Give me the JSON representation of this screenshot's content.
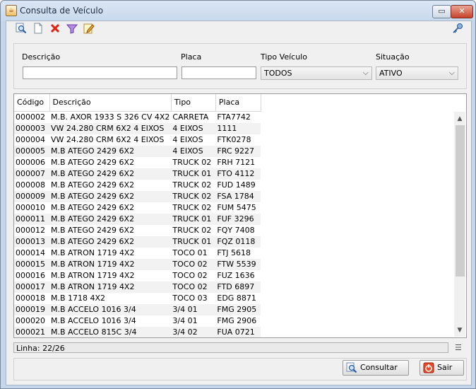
{
  "window": {
    "title": "Consulta de Veículo"
  },
  "toolbar": {
    "icons": [
      "search-document-icon",
      "new-document-icon",
      "delete-icon",
      "filter-icon",
      "edit-icon",
      "key-icon"
    ]
  },
  "filters": {
    "descricao_label": "Descrição",
    "descricao_value": "",
    "placa_label": "Placa",
    "placa_value": "",
    "tipo_label": "Tipo Veículo",
    "tipo_value": "TODOS",
    "situacao_label": "Situação",
    "situacao_value": "ATIVO"
  },
  "table": {
    "headers": [
      "Código",
      "Descrição",
      "Tipo",
      "Placa"
    ],
    "rows": [
      [
        "000002",
        "M.B. AXOR 1933 S 326 CV 4X2",
        "CARRETA",
        "FTA7742"
      ],
      [
        "000003",
        "VW 24.280 CRM 6X2 4 EIXOS",
        "4 EIXOS",
        "1111"
      ],
      [
        "000004",
        "VW 24.280 CRM 6X2 4 EIXOS",
        "4 EIXOS",
        "FTK0278"
      ],
      [
        "000005",
        "M.B ATEGO 2429 6X2",
        "4 EIXOS",
        "FRC 9227"
      ],
      [
        "000006",
        "M.B ATEGO 2429 6X2",
        "TRUCK 02",
        "FRH 7121"
      ],
      [
        "000007",
        "M.B ATEGO 2429 6X2",
        "TRUCK 01",
        "FTO 4112"
      ],
      [
        "000008",
        "M.B ATEGO 2429 6X2",
        "TRUCK 02",
        "FUD 1489"
      ],
      [
        "000009",
        "M.B ATEGO 2429 6X2",
        "TRUCK 02",
        "FSA 1784"
      ],
      [
        "000010",
        "M.B ATEGO 2429 6X2",
        "TRUCK 02",
        "FUM 5475"
      ],
      [
        "000011",
        "M.B ATEGO 2429 6X2",
        "TRUCK 01",
        "FUF 3296"
      ],
      [
        "000012",
        "M.B ATEGO 2429 6X2",
        "TRUCK 02",
        "FQY 7408"
      ],
      [
        "000013",
        "M.B ATEGO 2429 6X2",
        "TRUCK 01",
        "FQZ 0118"
      ],
      [
        "000014",
        "M.B ATRON 1719 4X2",
        "TOCO 01",
        "FTJ 5618"
      ],
      [
        "000015",
        "M.B ATRON 1719 4X2",
        "TOCO 02",
        "FTW 5539"
      ],
      [
        "000016",
        "M.B ATRON 1719 4X2",
        "TOCO 02",
        "FUZ 1636"
      ],
      [
        "000017",
        "M.B ATRON 1719 4X2",
        "TOCO 02",
        "FTD 6897"
      ],
      [
        "000018",
        "M.B 1718 4X2",
        "TOCO 03",
        "EDG 8871"
      ],
      [
        "000019",
        "M.B ACCELO 1016 3/4",
        "3/4  01",
        "FMG 2905"
      ],
      [
        "000020",
        "M.B ACCELO 1016 3/4",
        "3/4  01",
        "FMG 2906"
      ],
      [
        "000021",
        "M.B ACCELO 815C 3/4",
        "3/4  02",
        "FUA 0721"
      ]
    ]
  },
  "status": {
    "text": "Linha: 22/26"
  },
  "buttons": {
    "consultar": "Consultar",
    "sair": "Sair"
  }
}
